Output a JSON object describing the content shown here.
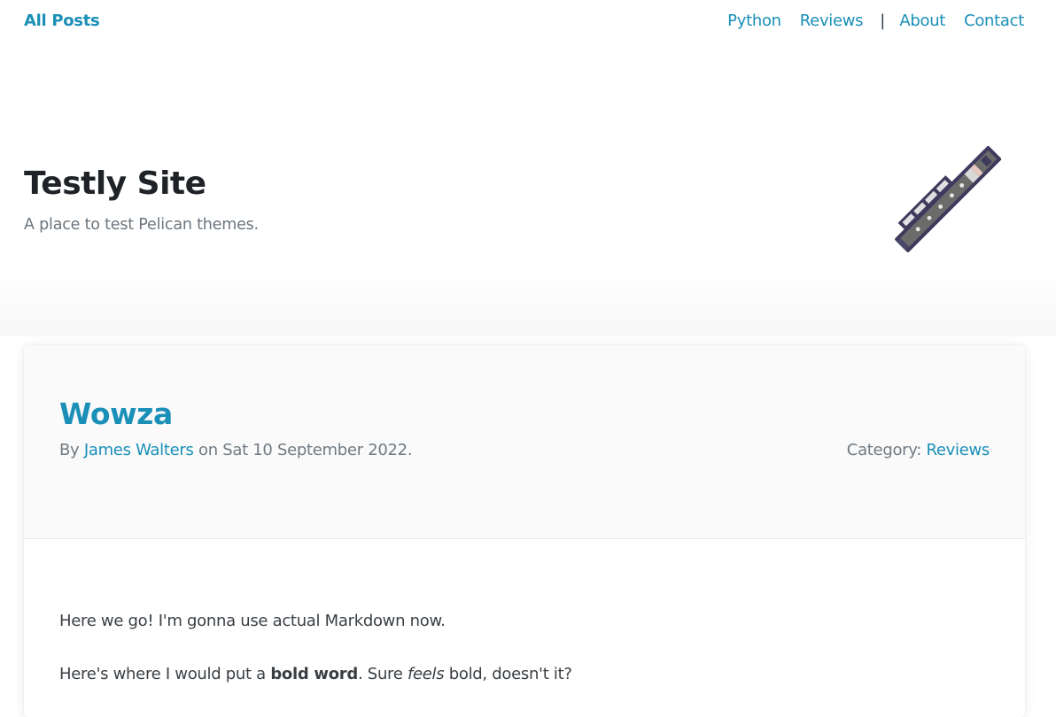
{
  "nav": {
    "brand": "All Posts",
    "links": [
      "Python",
      "Reviews",
      "About",
      "Contact"
    ],
    "separator": "|"
  },
  "hero": {
    "title": "Testly Site",
    "subtitle": "A place to test Pelican themes.",
    "logo_icon": "flute-icon"
  },
  "post": {
    "title": "Wowza",
    "by_label": "By",
    "author": "James Walters",
    "on_text": "on Sat 10 September 2022.",
    "category_label": "Category:",
    "category": "Reviews",
    "p1": "Here we go! I'm gonna use actual Markdown now.",
    "p2_before": "Here's where I would put a ",
    "p2_bold": "bold word",
    "p2_mid": ". Sure ",
    "p2_italic": "feels",
    "p2_after": " bold, doesn't it?"
  },
  "colors": {
    "accent": "#1a8fb7",
    "heading": "#1f2328",
    "muted": "#707a82"
  }
}
